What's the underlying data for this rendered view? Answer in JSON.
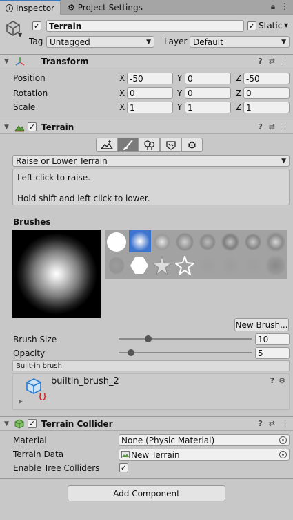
{
  "tabs": [
    {
      "label": "Inspector",
      "icon": "info-icon"
    },
    {
      "label": "Project Settings",
      "icon": "gear-icon"
    }
  ],
  "header": {
    "name": "Terrain",
    "static_label": "Static",
    "tag_label": "Tag",
    "tag_value": "Untagged",
    "layer_label": "Layer",
    "layer_value": "Default"
  },
  "transform": {
    "title": "Transform",
    "rows": [
      {
        "label": "Position",
        "x": "-50",
        "y": "0",
        "z": "-50"
      },
      {
        "label": "Rotation",
        "x": "0",
        "y": "0",
        "z": "0"
      },
      {
        "label": "Scale",
        "x": "1",
        "y": "1",
        "z": "1"
      }
    ],
    "axes": [
      "X",
      "Y",
      "Z"
    ]
  },
  "terrain": {
    "title": "Terrain",
    "mode": "Raise or Lower Terrain",
    "help_line1": "Left click to raise.",
    "help_line2": "Hold shift and left click to lower.",
    "brushes_label": "Brushes",
    "new_brush": "New Brush...",
    "brush_size_label": "Brush Size",
    "brush_size_value": "10",
    "brush_size_fraction": 0.21,
    "opacity_label": "Opacity",
    "opacity_value": "5",
    "opacity_fraction": 0.07,
    "builtin_label": "Built-in brush",
    "brush_name": "builtin_brush_2"
  },
  "collider": {
    "title": "Terrain Collider",
    "material_label": "Material",
    "material_value": "None (Physic Material)",
    "data_label": "Terrain Data",
    "data_value": "New Terrain",
    "trees_label": "Enable Tree Colliders"
  },
  "add_component": "Add Component",
  "colors": {
    "accent": "#3a79bb",
    "selected_brush": "#3d74d0"
  }
}
